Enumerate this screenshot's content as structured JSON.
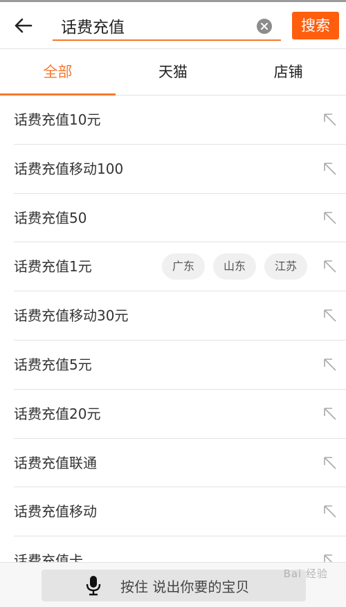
{
  "header": {
    "search_value": "话费充值",
    "search_button": "搜索",
    "back_icon": "arrow-left-icon",
    "clear_icon": "clear-circle-icon"
  },
  "tabs": [
    {
      "label": "全部",
      "active": true
    },
    {
      "label": "天猫",
      "active": false
    },
    {
      "label": "店铺",
      "active": false
    }
  ],
  "suggestions": [
    {
      "text": "话费充值10元"
    },
    {
      "text": "话费充值移动100"
    },
    {
      "text": "话费充值50"
    },
    {
      "text": "话费充值1元",
      "tags": [
        "广东",
        "山东",
        "江苏"
      ]
    },
    {
      "text": "话费充值移动30元"
    },
    {
      "text": "话费充值5元"
    },
    {
      "text": "话费充值20元"
    },
    {
      "text": "话费充值联通"
    },
    {
      "text": "话费充值移动"
    },
    {
      "text": "话费充值卡"
    }
  ],
  "voice": {
    "label": "按住 说出你要的宝贝",
    "icon": "microphone-icon"
  },
  "watermark": "Bai 经验",
  "colors": {
    "accent": "#f5782d",
    "search_button": "#ff5e0e"
  }
}
